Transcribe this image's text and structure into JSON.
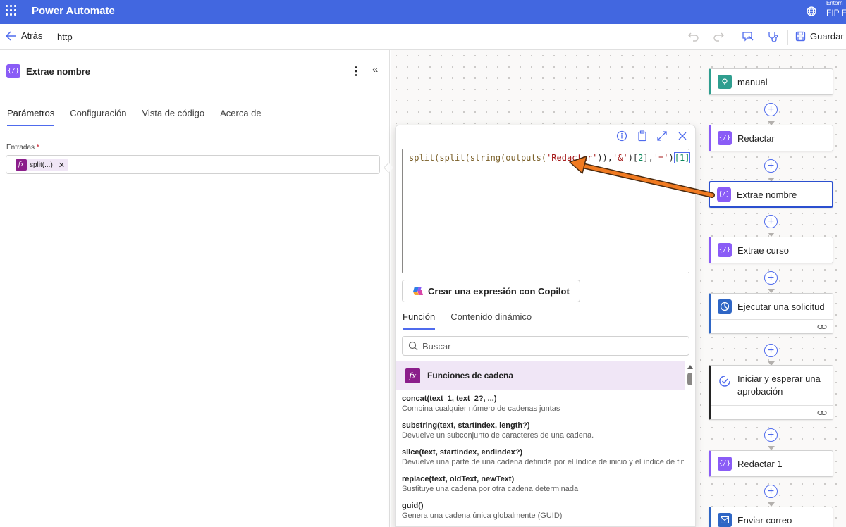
{
  "app": {
    "title": "Power Automate",
    "environment_label": "Entorn",
    "environment_name": "FIP F"
  },
  "command_bar": {
    "back_label": "Atrás",
    "flow_name": "http",
    "save_label": "Guardar"
  },
  "panel": {
    "title": "Extrae nombre",
    "tabs": [
      {
        "label": "Parámetros",
        "active": true
      },
      {
        "label": "Configuración",
        "active": false
      },
      {
        "label": "Vista de código",
        "active": false
      },
      {
        "label": "Acerca de",
        "active": false
      }
    ],
    "field_label": "Entradas",
    "field_required_mark": "*",
    "token_label": "split(...)",
    "token_icon_text": "fx"
  },
  "expression_editor": {
    "code": {
      "p1": "split(split(string(outputs(",
      "s1": "'Redactar'",
      "p2": ")),",
      "s2": "'&'",
      "p3": ")[",
      "n1": "2",
      "p4": "],",
      "s3": "'='",
      "p5": ")",
      "sel": "[1]"
    },
    "copilot_label": "Crear una expresión con Copilot",
    "tabs": [
      {
        "label": "Función",
        "active": true
      },
      {
        "label": "Contenido dinámico",
        "active": false
      }
    ],
    "search_placeholder": "Buscar",
    "category_label": "Funciones de cadena",
    "functions": [
      {
        "signature": "concat(text_1, text_2?, ...)",
        "description": "Combina cualquier número de cadenas juntas"
      },
      {
        "signature": "substring(text, startIndex, length?)",
        "description": "Devuelve un subconjunto de caracteres de una cadena."
      },
      {
        "signature": "slice(text, startIndex, endIndex?)",
        "description": "Devuelve una parte de una cadena definida por el índice de inicio y el índice de fin"
      },
      {
        "signature": "replace(text, oldText, newText)",
        "description": "Sustituye una cadena por otra cadena determinada"
      },
      {
        "signature": "guid()",
        "description": "Genera una cadena única globalmente (GUID)"
      }
    ]
  },
  "flow": {
    "nodes": [
      {
        "label": "manual",
        "icon": "trigger-icon",
        "color": "#2f9e8f"
      },
      {
        "label": "Redactar",
        "icon": "compose-icon",
        "color": "#8a5cf6"
      },
      {
        "label": "Extrae nombre",
        "icon": "compose-icon",
        "color": "#8a5cf6",
        "selected": true
      },
      {
        "label": "Extrae curso",
        "icon": "compose-icon",
        "color": "#8a5cf6"
      },
      {
        "label": "Ejecutar una solicitud",
        "icon": "http-icon",
        "color": "#2f66c5"
      },
      {
        "label": "Iniciar y esperar una aprobación",
        "icon": "approval-icon",
        "color": "#242424"
      },
      {
        "label": "Redactar 1",
        "icon": "compose-icon",
        "color": "#8a5cf6"
      },
      {
        "label": "Enviar correo",
        "icon": "mail-icon",
        "color": "#2f66c5"
      }
    ]
  },
  "colors": {
    "topbar": "#4267e0",
    "accent": "#4f6bed",
    "annotation_arrow": "#f07a21"
  }
}
